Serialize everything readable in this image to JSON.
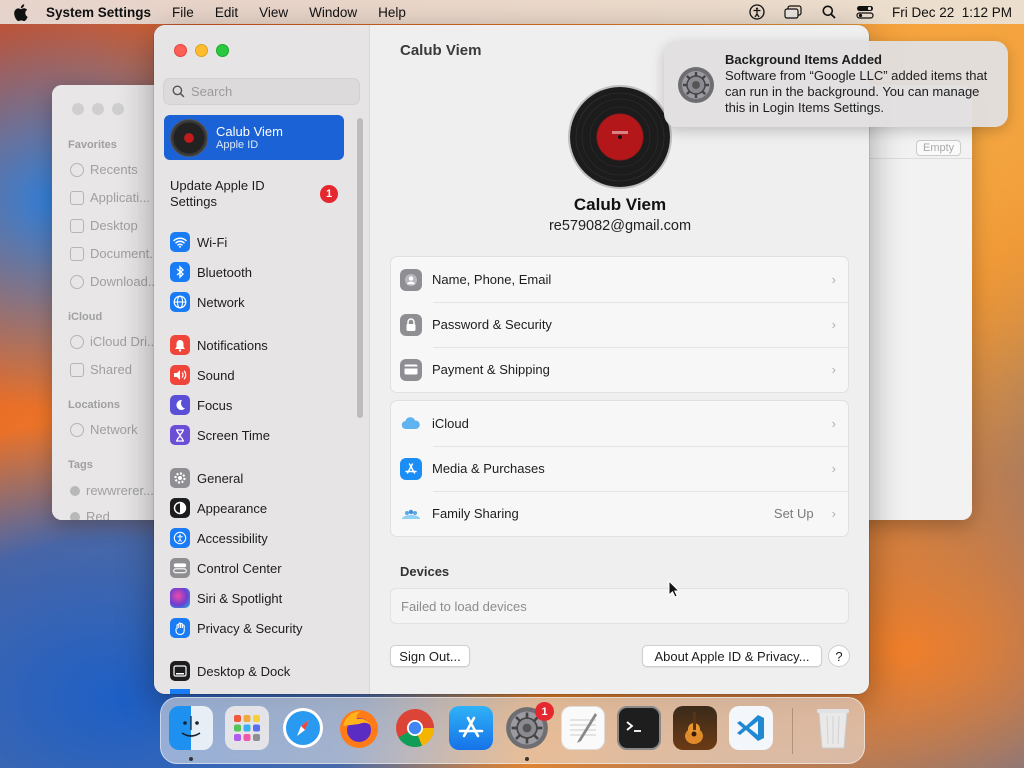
{
  "menubar": {
    "app_name": "System Settings",
    "menus": [
      "File",
      "Edit",
      "View",
      "Window",
      "Help"
    ],
    "clock": "Fri Dec 22  1:12 PM"
  },
  "finder": {
    "sections": {
      "favorites": "Favorites",
      "icloud": "iCloud",
      "locations": "Locations",
      "tags": "Tags"
    },
    "items": {
      "recents": "Recents",
      "applications": "Applicati...",
      "desktop": "Desktop",
      "documents": "Document...",
      "downloads": "Download...",
      "icloud_drive": "iCloud Dri...",
      "shared": "Shared",
      "network": "Network",
      "tag1": "rewwrerer...",
      "tag2": "Red"
    },
    "empty_button": "Empty"
  },
  "sidebar": {
    "search_placeholder": "Search",
    "user": {
      "name": "Calub Viem",
      "subtitle": "Apple ID"
    },
    "update_notice": "Update Apple ID Settings",
    "update_badge": "1",
    "items": [
      {
        "label": "Wi-Fi",
        "icon": "wifi-icon",
        "color": "#1a7cf5"
      },
      {
        "label": "Bluetooth",
        "icon": "bluetooth-icon",
        "color": "#1a7cf5"
      },
      {
        "label": "Network",
        "icon": "globe-icon",
        "color": "#1a7cf5"
      },
      {
        "label": "Notifications",
        "icon": "bell-icon",
        "color": "#f0453a"
      },
      {
        "label": "Sound",
        "icon": "speaker-icon",
        "color": "#f0453a"
      },
      {
        "label": "Focus",
        "icon": "moon-icon",
        "color": "#5a4fd6"
      },
      {
        "label": "Screen Time",
        "icon": "hourglass-icon",
        "color": "#6c4fd6"
      },
      {
        "label": "General",
        "icon": "gear-icon",
        "color": "#8e8e93"
      },
      {
        "label": "Appearance",
        "icon": "appearance-icon",
        "color": "#1d1d1f"
      },
      {
        "label": "Accessibility",
        "icon": "accessibility-icon",
        "color": "#1a7cf5"
      },
      {
        "label": "Control Center",
        "icon": "control-center-icon",
        "color": "#8e8e93"
      },
      {
        "label": "Siri & Spotlight",
        "icon": "siri-icon",
        "color": "#6a3fd0"
      },
      {
        "label": "Privacy & Security",
        "icon": "hand-icon",
        "color": "#1a7cf5"
      },
      {
        "label": "Desktop & Dock",
        "icon": "dock-icon",
        "color": "#1d1d1f"
      }
    ]
  },
  "main": {
    "title": "Calub Viem",
    "user_name": "Calub Viem",
    "email": "re579082@gmail.com",
    "group1": [
      {
        "label": "Name, Phone, Email",
        "icon": "contact-icon",
        "value": ""
      },
      {
        "label": "Password & Security",
        "icon": "lock-icon",
        "value": ""
      },
      {
        "label": "Payment & Shipping",
        "icon": "card-icon",
        "value": ""
      }
    ],
    "group2": [
      {
        "label": "iCloud",
        "icon": "icloud-icon",
        "value": ""
      },
      {
        "label": "Media & Purchases",
        "icon": "appstore-icon",
        "value": ""
      },
      {
        "label": "Family Sharing",
        "icon": "family-icon",
        "value": "Set Up"
      }
    ],
    "devices_title": "Devices",
    "devices_status": "Failed to load devices",
    "sign_out": "Sign Out...",
    "about": "About Apple ID & Privacy...",
    "help": "?"
  },
  "notification": {
    "title": "Background Items Added",
    "body": "Software from “Google LLC” added items that can run in the background. You can manage this in Login Items Settings."
  },
  "dock": {
    "apps": [
      "Finder",
      "Launchpad",
      "Safari",
      "Firefox",
      "Chrome",
      "App Store",
      "System Settings",
      "TextEdit",
      "Terminal",
      "GarageBand",
      "VS Code",
      "Trash"
    ],
    "settings_badge": "1"
  }
}
